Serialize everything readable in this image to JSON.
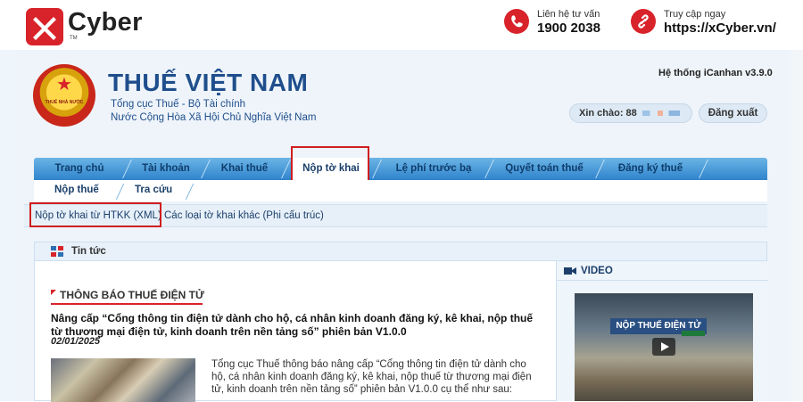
{
  "brand": {
    "name": "Cyber",
    "tm": "TM",
    "hotline_label": "Liên hệ tư vấn",
    "hotline_number": "1900 2038",
    "access_label": "Truy cập ngay",
    "access_url": "https://xCyber.vn/",
    "accent_color": "#d8232a"
  },
  "header": {
    "emblem_text": "THUẾ NHÀ NƯỚC",
    "title": "THUẾ VIỆT NAM",
    "subtitle1": "Tổng cục Thuế - Bộ Tài chính",
    "subtitle2": "Nước Cộng Hòa Xã Hội Chủ Nghĩa Việt Nam",
    "system_version": "Hệ thống iCanhan v3.9.0",
    "greeting": "Xin chào: 88",
    "logout": "Đăng xuất"
  },
  "nav": {
    "tabs": [
      {
        "label": "Trang chủ"
      },
      {
        "label": "Tài khoản"
      },
      {
        "label": "Khai thuế"
      },
      {
        "label": "Nộp tờ khai",
        "active": true
      },
      {
        "label": "Lệ phí trước bạ"
      },
      {
        "label": "Quyết toán thuế"
      },
      {
        "label": "Đăng ký thuế"
      }
    ]
  },
  "subnav": {
    "items": [
      {
        "label": "Nộp thuế"
      },
      {
        "label": "Tra cứu"
      }
    ]
  },
  "thirdnav": {
    "items": [
      {
        "label": "Nộp tờ khai từ HTKK (XML)"
      },
      {
        "label": "Các loại tờ khai khác (Phi cấu trúc)"
      }
    ]
  },
  "news": {
    "section_title": "Tin tức",
    "category": "THÔNG BÁO THUẾ ĐIỆN TỬ",
    "headline": "Nâng cấp “Cổng thông tin điện tử dành cho hộ, cá nhân kinh doanh đăng ký, kê khai, nộp thuế từ thương mại điện tử, kinh doanh trên nền tảng số” phiên bản V1.0.0",
    "date": "02/01/2025",
    "summary": "Tổng cục Thuế thông báo nâng cấp “Cổng thông tin điện tử dành cho hộ, cá nhân kinh doanh đăng ký, kê khai, nộp thuế từ thương mại điện tử, kinh doanh trên nền tảng số” phiên bản V1.0.0 cụ thể như sau:"
  },
  "video": {
    "section_title": "VIDEO",
    "banner": "NỘP THUẾ ĐIỆN TỬ"
  }
}
